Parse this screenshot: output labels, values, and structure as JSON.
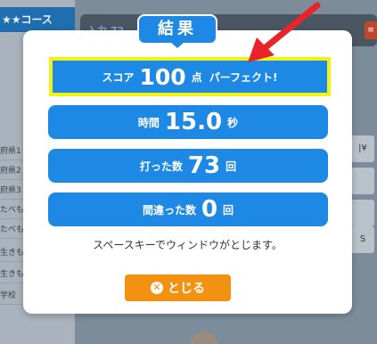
{
  "background": {
    "course_title": "★★コース",
    "list_items": [
      "府県1",
      "府県2",
      "府県3",
      "たべも",
      "たべも",
      "生きも",
      "生きも",
      "学校"
    ],
    "topbar_label": "入力 72",
    "right_button": "≡",
    "keys": [
      "|¥",
      "",
      "",
      "S"
    ]
  },
  "modal": {
    "title": "結果",
    "score": {
      "prefix": "スコア",
      "value": "100",
      "unit": "点",
      "suffix": "パーフェクト!"
    },
    "time": {
      "label": "時間",
      "value": "15.0",
      "unit": "秒"
    },
    "typed": {
      "label": "打った数",
      "value": "73",
      "unit": "回"
    },
    "missed": {
      "label": "間違った数",
      "value": "0",
      "unit": "回"
    },
    "hint": "スペースキーでウィンドウがとじます。",
    "close_button": {
      "label": "とじる",
      "icon": "close-circle-icon"
    }
  },
  "colors": {
    "accent_blue": "#1e88e5",
    "highlight_yellow": "#f3f313",
    "close_orange": "#f39112",
    "annotation_red": "#e8232a"
  }
}
